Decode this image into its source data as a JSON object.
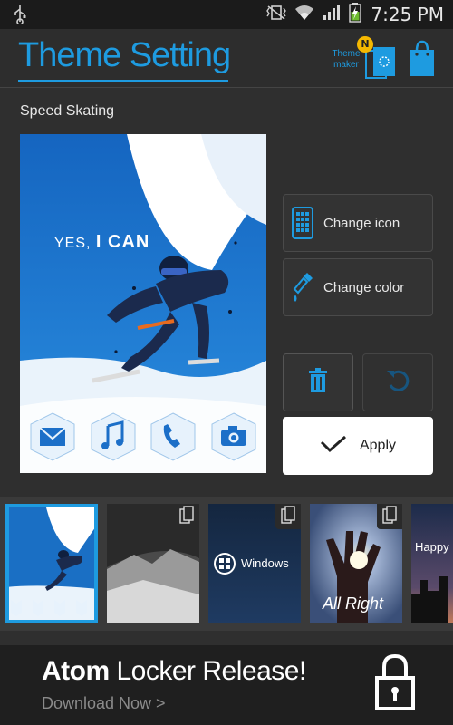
{
  "status_bar": {
    "time": "7:25 PM"
  },
  "header": {
    "title": "Theme Setting",
    "theme_maker_label_line1": "Theme",
    "theme_maker_label_line2": "maker",
    "theme_maker_badge": "N"
  },
  "theme": {
    "name": "Speed Skating",
    "slogan_part1": "YES,",
    "slogan_part2": "I CAN"
  },
  "actions": {
    "change_icon": "Change icon",
    "change_color": "Change color",
    "apply": "Apply"
  },
  "thumbnails": [
    {
      "label": ""
    },
    {
      "label": ""
    },
    {
      "label": "Windows"
    },
    {
      "label": "All Right"
    },
    {
      "label": "Happy N"
    }
  ],
  "banner": {
    "headline_bold": "Atom",
    "headline_rest": "Locker Release!",
    "subtext": "Download Now >"
  },
  "colors": {
    "accent": "#1e9be0",
    "background": "#2f2f2f"
  }
}
